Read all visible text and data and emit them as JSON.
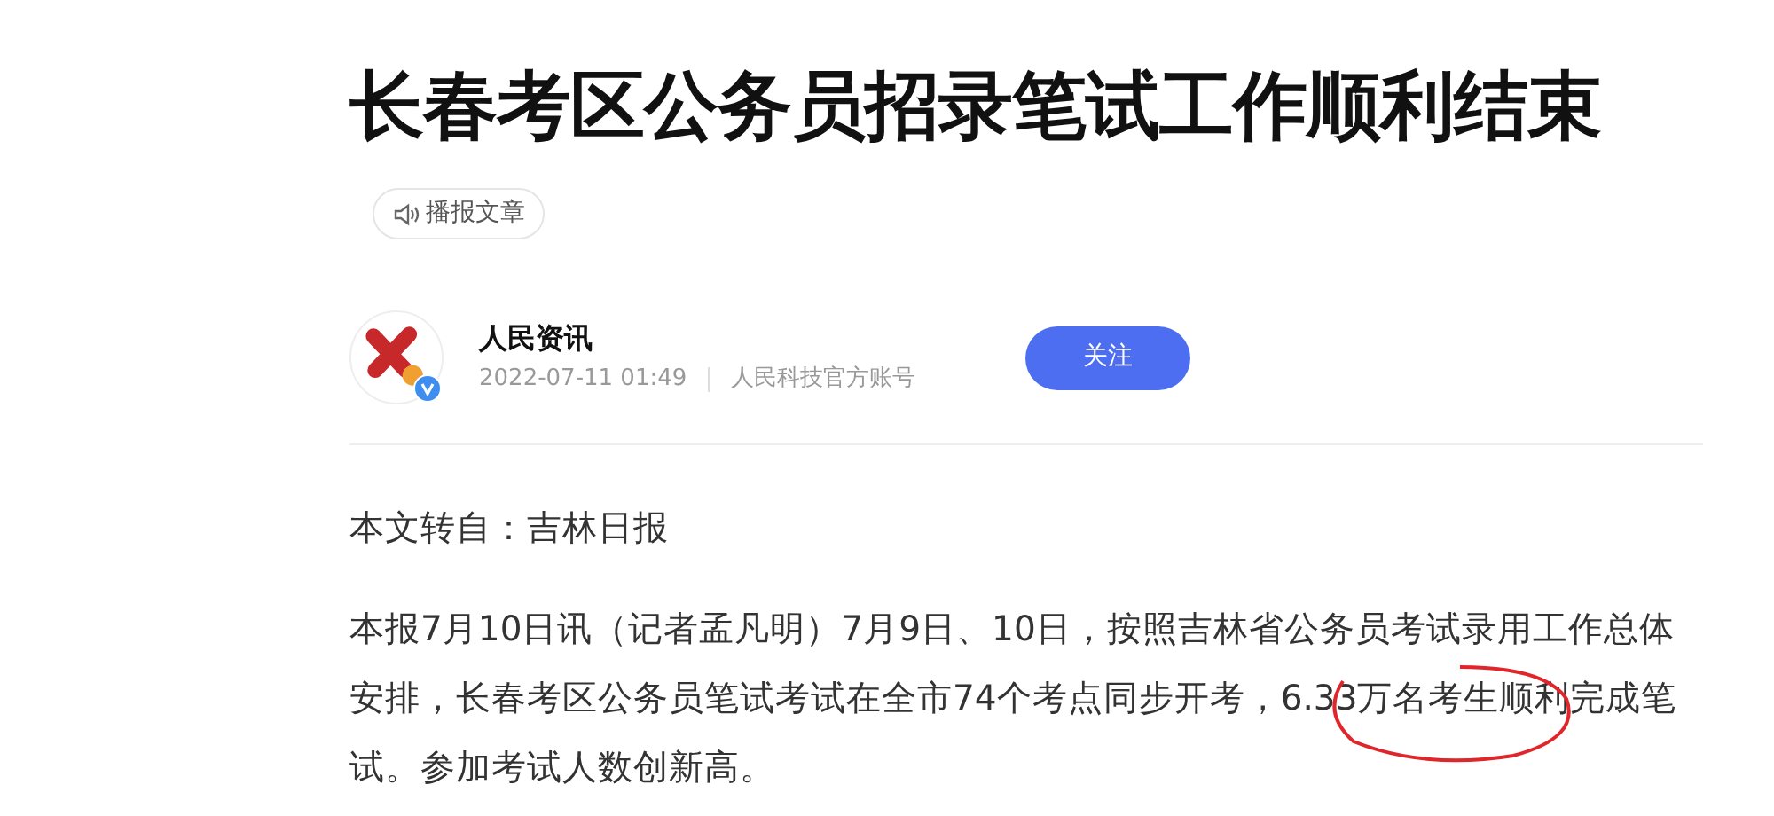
{
  "title": "长春考区公务员招录笔试工作顺利结束",
  "listen_button": {
    "label": "播报文章"
  },
  "author": {
    "name": "人民资讯",
    "verified": true,
    "time": "2022-07-11 01:49",
    "account": "人民科技官方账号",
    "follow_label": "关注"
  },
  "paragraphs": [
    "本文转自：吉林日报",
    "本报7月10日讯（记者孟凡明）7月9日、10日，按照吉林省公务员考试录用工作总体安排，长春考区公务员笔试考试在全市74个考点同步开考，6.33万名考生顺利完成笔试。参加考试人数创新高。"
  ]
}
